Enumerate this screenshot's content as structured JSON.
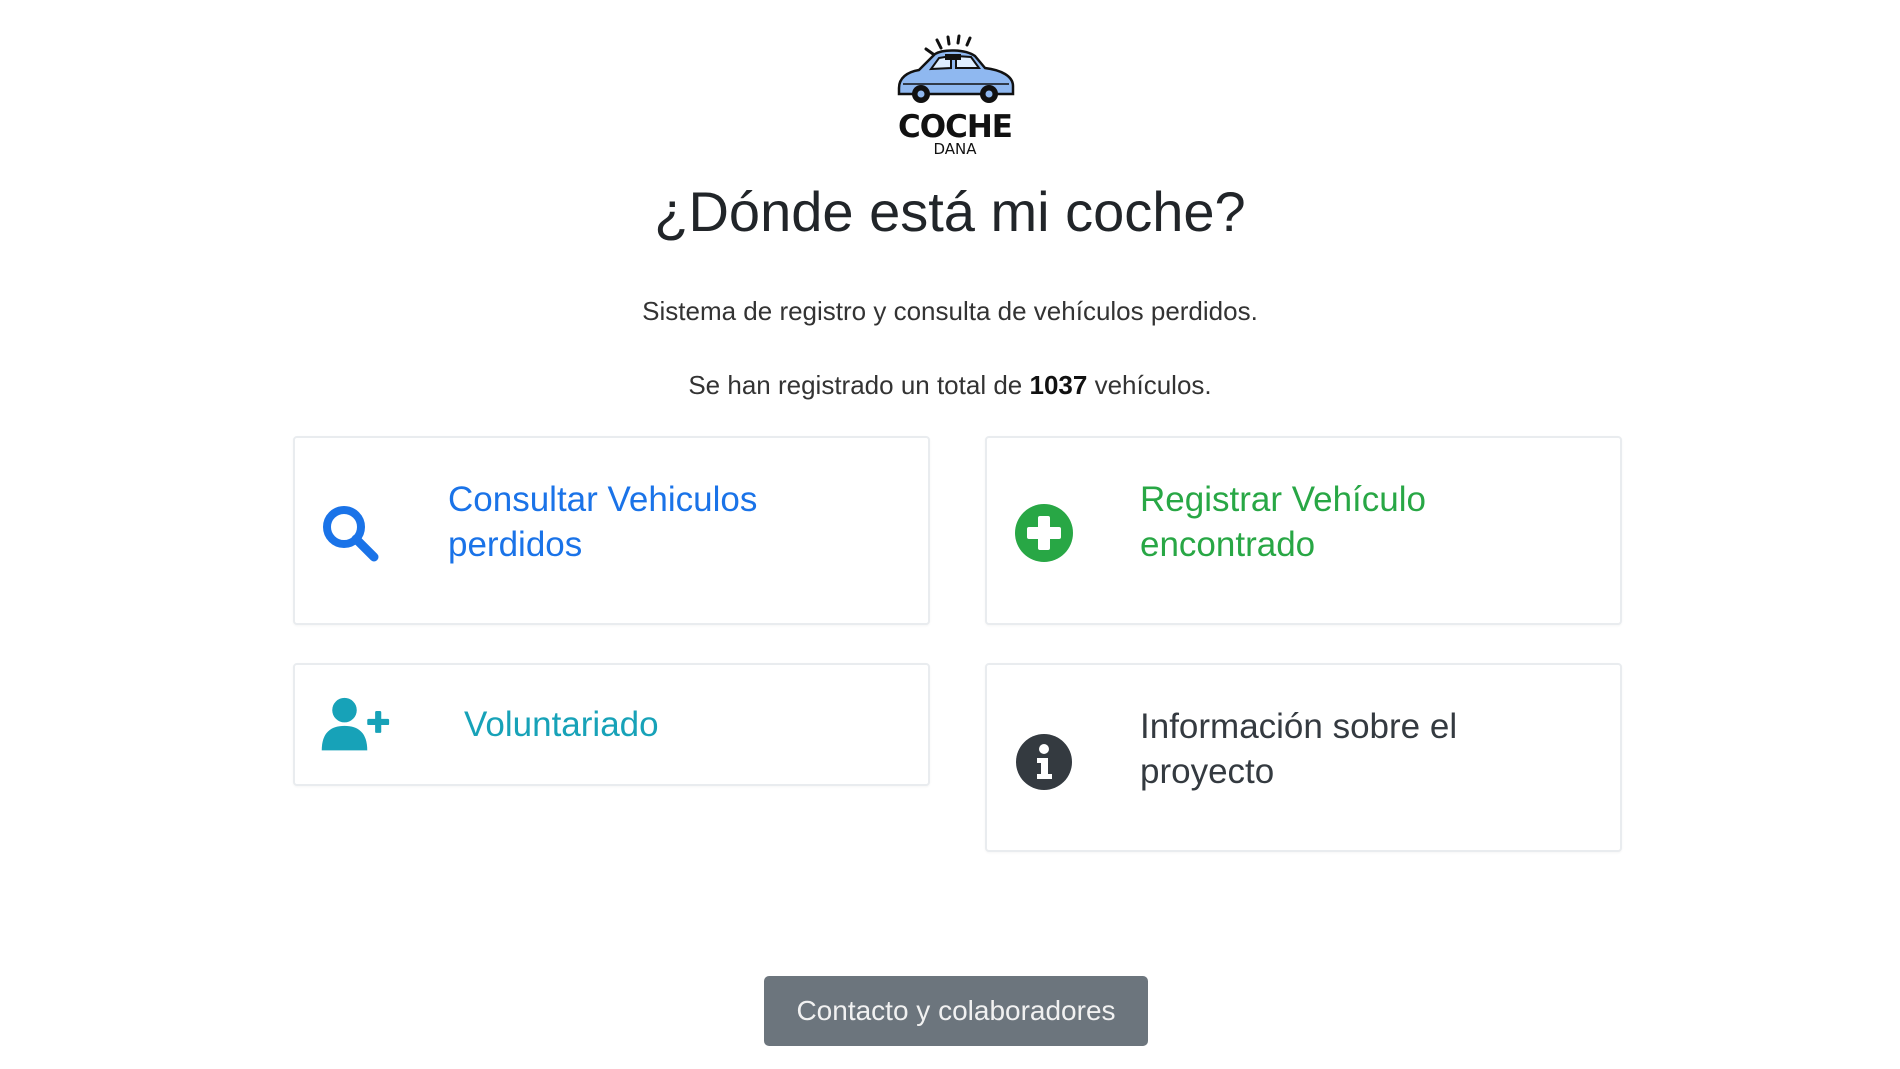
{
  "logo": {
    "word": "COCHE",
    "sub": "DANA"
  },
  "header": {
    "title": "¿Dónde está mi coche?",
    "subtitle": "Sistema de registro y consulta de vehículos perdidos.",
    "count_prefix": "Se han registrado un total de",
    "count_value": "1037",
    "count_suffix": "vehículos."
  },
  "cards": {
    "consultar": {
      "line1": "Consultar Vehiculos",
      "line2": "perdidos",
      "icon": "search-icon",
      "color": "#1a73e8"
    },
    "registrar": {
      "line1": "Registrar Vehículo",
      "line2": "encontrado",
      "icon": "plus-circle-icon",
      "color": "#28a745"
    },
    "voluntariado": {
      "label": "Voluntariado",
      "icon": "user-plus-icon",
      "color": "#17a2b8"
    },
    "informacion": {
      "line1": "Información sobre el",
      "line2": "proyecto",
      "icon": "info-circle-icon",
      "color": "#343a40"
    }
  },
  "footer": {
    "contact_label": "Contacto y colaboradores"
  }
}
